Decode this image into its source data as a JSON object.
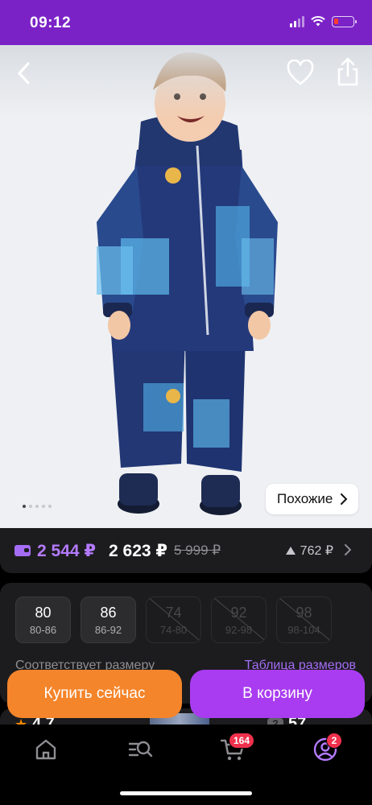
{
  "status_bar": {
    "time": "09:12"
  },
  "product": {
    "image_alt": "Детский зимний комбинезон с принтом",
    "similar_label": "Похожие",
    "gallery_count": 5
  },
  "price": {
    "wallet_price": "2 544 ₽",
    "price": "2 623 ₽",
    "old_price": "5 999 ₽",
    "bonus": "762 ₽"
  },
  "sizes": [
    {
      "size": "80",
      "range": "80-86",
      "available": true
    },
    {
      "size": "86",
      "range": "86-92",
      "available": true
    },
    {
      "size": "74",
      "range": "74-80",
      "available": false
    },
    {
      "size": "92",
      "range": "92-98",
      "available": false
    },
    {
      "size": "98",
      "range": "98-104",
      "available": false
    }
  ],
  "size_fit": {
    "text": "Соответствует размеру",
    "chart_link": "Таблица размеров"
  },
  "rating": {
    "value": "4.7",
    "questions": "57"
  },
  "actions": {
    "buy_now": "Купить сейчас",
    "add_to_cart": "В корзину"
  },
  "tabbar": {
    "cart_badge": "164",
    "profile_badge": "2"
  },
  "colors": {
    "brand": "#7b22c7",
    "buy_now": "#f5852b",
    "cart": "#a93cf0",
    "accent_text": "#b57bff",
    "badge": "#f0314d"
  }
}
